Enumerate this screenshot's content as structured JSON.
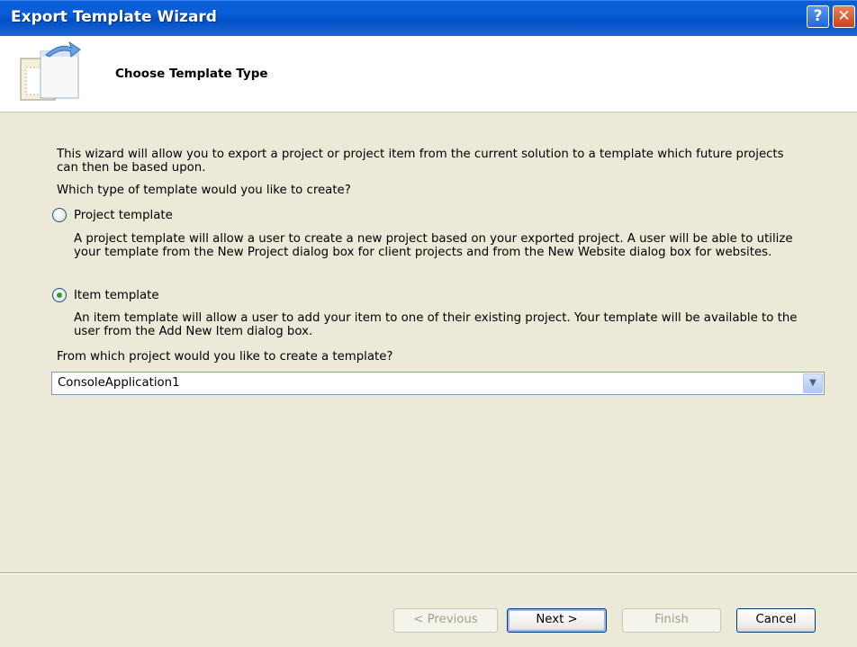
{
  "window": {
    "title": "Export Template Wizard"
  },
  "header": {
    "title": "Choose Template Type"
  },
  "content": {
    "intro": "This wizard will allow you to export a project or project item from the current solution to a template which future projects can then be based upon.",
    "question": "Which type of template would you like to create?",
    "options": [
      {
        "label": "Project template",
        "selected": false,
        "description": "A project template will allow a user to create a new project based on your exported project. A user will be able to utilize your template from the New Project dialog box for client projects and from the New Website dialog box for websites."
      },
      {
        "label": "Item template",
        "selected": true,
        "description": "An item template will allow a user to add your item to one of their existing project. Your template will be available to the user from the Add New Item dialog box."
      }
    ],
    "project_question": "From which project would you like to create a template?",
    "project_select": {
      "value": "ConsoleApplication1"
    }
  },
  "buttons": {
    "previous": "< Previous",
    "next": "Next >",
    "finish": "Finish",
    "cancel": "Cancel"
  }
}
